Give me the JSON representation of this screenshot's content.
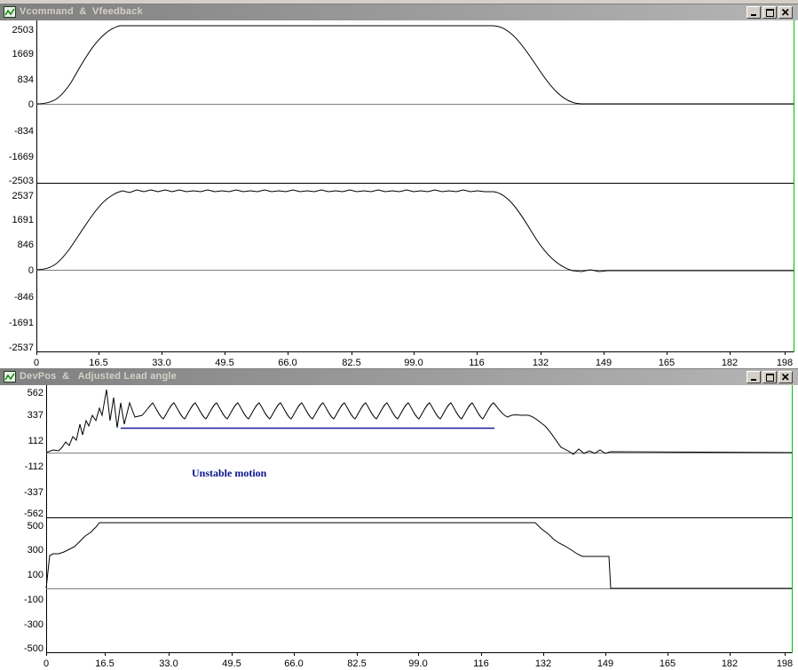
{
  "window1": {
    "title": "Vcommand  &  Vfeedback",
    "plot_top": {
      "y_ticks": [
        "2503",
        "1669",
        "834",
        "0",
        "-834",
        "-1669",
        "-2503"
      ]
    },
    "plot_bottom": {
      "y_ticks": [
        "2537",
        "1691",
        "846",
        "0",
        "-846",
        "-1691",
        "-2537"
      ]
    },
    "x_ticks": [
      "0",
      "16.5",
      "33.0",
      "49.5",
      "66.0",
      "82.5",
      "99.0",
      "116",
      "132",
      "149",
      "165",
      "182",
      "198"
    ]
  },
  "window2": {
    "title": "DevPos  &   Adjusted Lead angle",
    "plot_top": {
      "y_ticks": [
        "562",
        "337",
        "112",
        "-112",
        "-337",
        "-562"
      ]
    },
    "plot_bottom": {
      "y_ticks": [
        "500",
        "300",
        "100",
        "-100",
        "-300",
        "-500"
      ]
    },
    "x_ticks": [
      "0",
      "16.5",
      "33.0",
      "49.5",
      "66.0",
      "82.5",
      "99.0",
      "116",
      "132",
      "149",
      "165",
      "182",
      "198"
    ],
    "annotation": "Unstable motion"
  },
  "colors": {
    "trace": "#000000",
    "zero_line": "#808080",
    "annotation": "#0a148c",
    "right_edge": "#00c000"
  }
}
